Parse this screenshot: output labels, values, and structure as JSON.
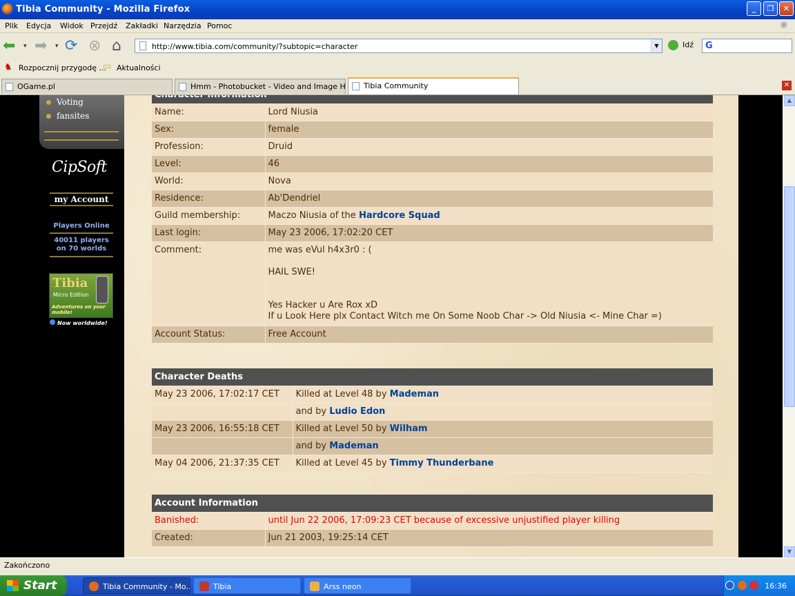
{
  "window": {
    "title": "Tibia Community - Mozilla Firefox"
  },
  "menu": [
    "Plik",
    "Edycja",
    "Widok",
    "Przejdź",
    "Zakładki",
    "Narzędzia",
    "Pomoc"
  ],
  "address": {
    "url": "http://www.tibia.com/community/?subtopic=character",
    "go_label": "Idź"
  },
  "bookmarks": [
    "Rozpocznij przygodę ...",
    "Aktualności"
  ],
  "tabs": [
    "OGame.pl",
    "Hmm - Photobucket - Video and Image Hosting",
    "Tibia Community"
  ],
  "sidebar": {
    "menu_items": [
      "Voting",
      "fansites"
    ],
    "logo_text": "CipSoft",
    "my_account": "my Account",
    "players_online_title": "Players Online",
    "players_online_text": "40011 players on 70 worlds",
    "tibiame": {
      "title": "Tibia",
      "subtitle": "Micro Edition",
      "tagline": "Adventures on your mobile!",
      "worldwide": "Now worldwide!"
    }
  },
  "character": {
    "header": "Character Information",
    "rows": [
      {
        "label": "Name:",
        "value": "Lord Niusia"
      },
      {
        "label": "Sex:",
        "value": "female"
      },
      {
        "label": "Profession:",
        "value": "Druid"
      },
      {
        "label": "Level:",
        "value": "46"
      },
      {
        "label": "World:",
        "value": "Nova"
      },
      {
        "label": "Residence:",
        "value": "Ab'Dendriel"
      }
    ],
    "guild_label": "Guild membership:",
    "guild_prefix": "Maczo Niusia of the",
    "guild_name": "Hardcore Squad",
    "last_login_label": "Last login:",
    "last_login": "May 23 2006, 17:02:20 CET",
    "comment_label": "Comment:",
    "comment_lines": [
      "me was eVul h4x3r0 : (",
      "HAIL SWE!",
      "Yes Hacker u Are Rox xD",
      "If u Look Here plx Contact Witch me On Some Noob Char -> Old Niusia <- Mine Char =)"
    ],
    "account_status_label": "Account Status:",
    "account_status": "Free Account"
  },
  "deaths": {
    "header": "Character Deaths",
    "rows": [
      {
        "date": "May 23 2006, 17:02:17 CET",
        "text": "Killed at Level 48 by",
        "killer": "Mademan"
      },
      {
        "date": "",
        "text": "and by",
        "killer": "Ludio Edon"
      },
      {
        "date": "May 23 2006, 16:55:18 CET",
        "text": "Killed at Level 50 by",
        "killer": "Wilham"
      },
      {
        "date": "",
        "text": "and by",
        "killer": "Mademan"
      },
      {
        "date": "May 04 2006, 21:37:35 CET",
        "text": "Killed at Level 45 by",
        "killer": "Timmy Thunderbane"
      }
    ]
  },
  "account": {
    "header": "Account Information",
    "banished_label": "Banished:",
    "banished_value": "until Jun 22 2006, 17:09:23 CET because of excessive unjustified player killing",
    "created_label": "Created:",
    "created_value": "Jun 21 2003, 19:25:14 CET"
  },
  "status": {
    "text": "Zakończono"
  },
  "taskbar": {
    "start": "Start",
    "tasks": [
      "Tibia Community - Mo...",
      "Tibia",
      "Arss neon"
    ],
    "clock": "16:36"
  },
  "colors": {
    "link": "#004294",
    "header_bg": "#505050",
    "row_light": "#f1e0c6",
    "row_dark": "#d5c0a1",
    "banished": "#ec0000"
  }
}
